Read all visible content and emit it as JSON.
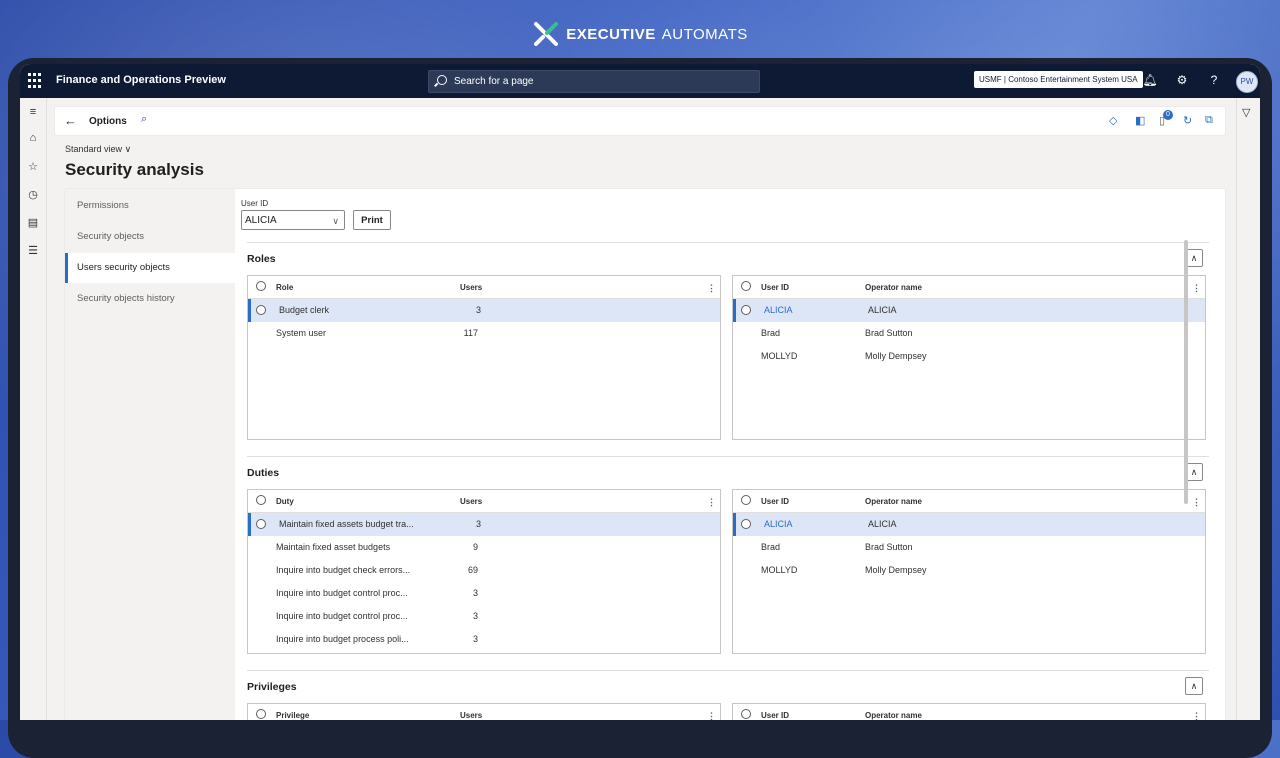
{
  "brand": {
    "bold": "EXECUTIVE",
    "light": "AUTOMATS"
  },
  "topbar": {
    "app_title": "Finance and Operations Preview",
    "search_placeholder": "Search for a page",
    "company": "USMF | Contoso Entertainment System USA",
    "help": "?",
    "avatar": "PW"
  },
  "actionbar": {
    "title": "Options",
    "badge": "0"
  },
  "view": {
    "label": "Standard view"
  },
  "page": {
    "title": "Security analysis"
  },
  "vtabs": [
    "Permissions",
    "Security objects",
    "Users security objects",
    "Security objects history"
  ],
  "form": {
    "user_id_label": "User ID",
    "user_id_value": "ALICIA",
    "print_label": "Print"
  },
  "roles": {
    "title": "Roles",
    "left_headers": [
      "Role",
      "Users"
    ],
    "left_rows": [
      {
        "name": "Budget clerk",
        "users": "3"
      },
      {
        "name": "System user",
        "users": "117"
      }
    ],
    "right_headers": [
      "User ID",
      "Operator name"
    ],
    "right_rows": [
      {
        "id": "ALICIA",
        "name": "ALICIA"
      },
      {
        "id": "Brad",
        "name": "Brad Sutton"
      },
      {
        "id": "MOLLYD",
        "name": "Molly Dempsey"
      }
    ]
  },
  "duties": {
    "title": "Duties",
    "left_headers": [
      "Duty",
      "Users"
    ],
    "left_rows": [
      {
        "name": "Maintain fixed assets budget tra...",
        "users": "3"
      },
      {
        "name": "Maintain fixed asset budgets",
        "users": "9"
      },
      {
        "name": "Inquire into budget check errors...",
        "users": "69"
      },
      {
        "name": "Inquire into budget control proc...",
        "users": "3"
      },
      {
        "name": "Inquire into budget control proc...",
        "users": "3"
      },
      {
        "name": "Inquire into budget process poli...",
        "users": "3"
      }
    ],
    "right_headers": [
      "User ID",
      "Operator name"
    ],
    "right_rows": [
      {
        "id": "ALICIA",
        "name": "ALICIA"
      },
      {
        "id": "Brad",
        "name": "Brad Sutton"
      },
      {
        "id": "MOLLYD",
        "name": "Molly Dempsey"
      }
    ]
  },
  "privileges": {
    "title": "Privileges",
    "left_headers": [
      "Privilege",
      "Users"
    ],
    "right_headers": [
      "User ID",
      "Operator name"
    ]
  }
}
